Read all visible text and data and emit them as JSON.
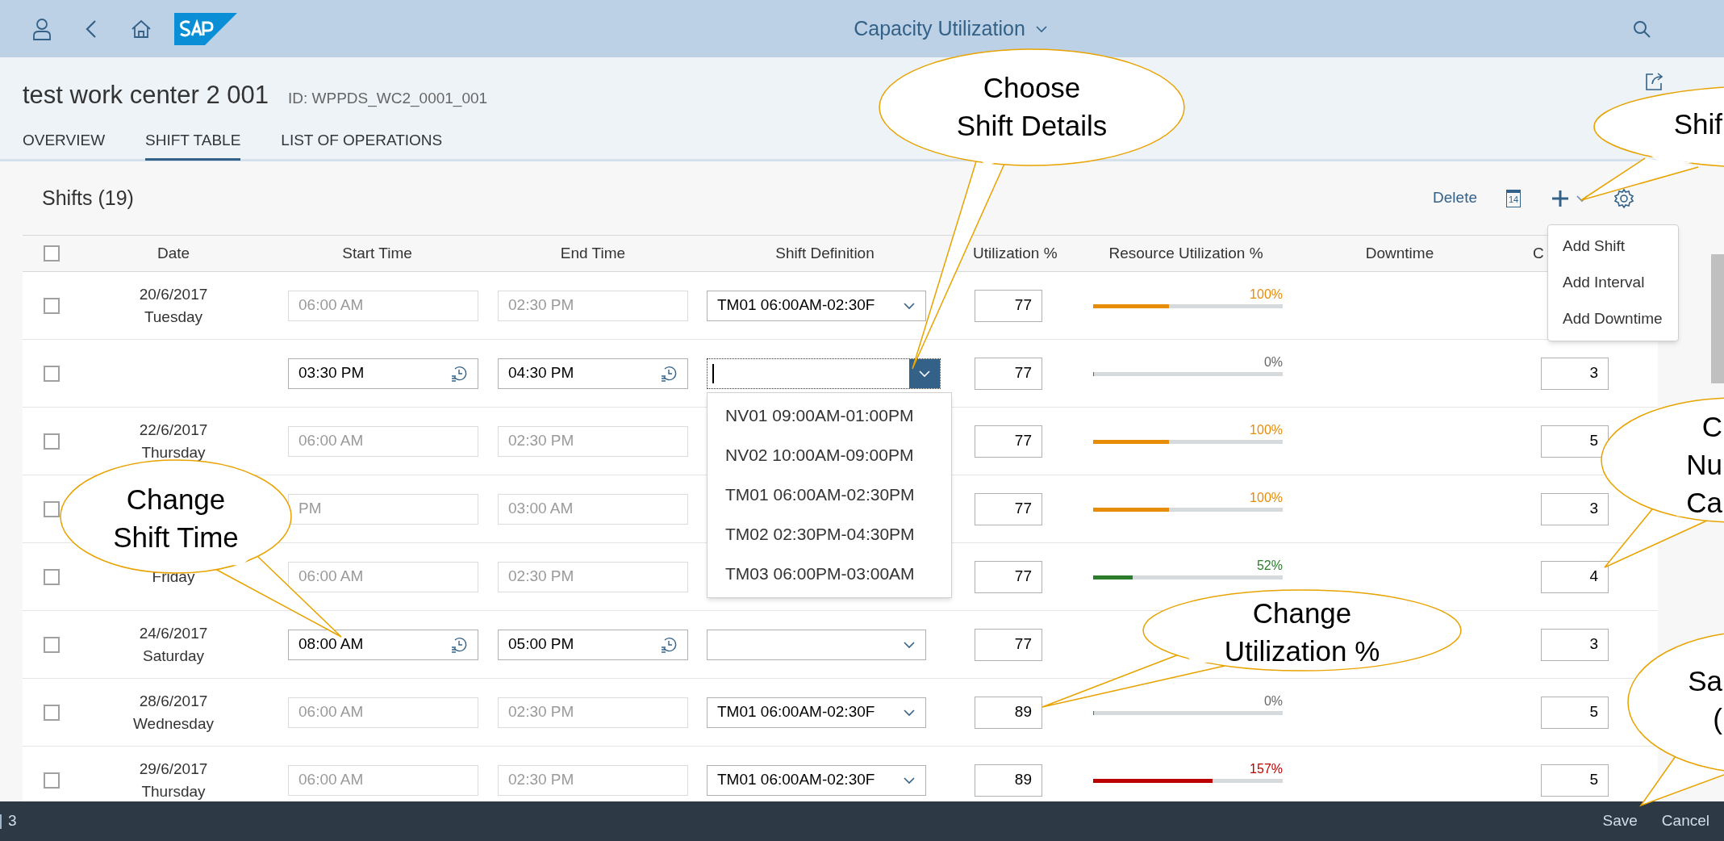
{
  "app_bar": {
    "title": "Capacity Utilization"
  },
  "object": {
    "title": "test work center 2 001",
    "id": "ID: WPPDS_WC2_0001_001"
  },
  "tabs": [
    {
      "label": "OVERVIEW",
      "selected": false
    },
    {
      "label": "SHIFT TABLE",
      "selected": true
    },
    {
      "label": "LIST OF OPERATIONS",
      "selected": false
    }
  ],
  "table": {
    "title": "Shifts (19)",
    "delete": "Delete",
    "calendar_day": "14",
    "add_menu": [
      "Add Shift",
      "Add Interval",
      "Add Downtime"
    ],
    "all_selected": false,
    "columns": [
      "Date",
      "Start Time",
      "End Time",
      "Shift Definition",
      "Utilization %",
      "Resource Utilization %",
      "Downtime",
      "C"
    ],
    "rows": [
      {
        "selected": false,
        "date": "20/6/2017",
        "day": "Tuesday",
        "start": {
          "value": "06:00 AM",
          "editable": false
        },
        "end": {
          "value": "02:30 PM",
          "editable": false
        },
        "shift": {
          "value": "TM01 06:00AM-02:30F",
          "open": false
        },
        "utilization": "77",
        "resource": {
          "reading": "100%",
          "level": 0.4,
          "color": "#e78c07"
        }
      },
      {
        "selected": false,
        "start": {
          "value": "03:30 PM",
          "editable": true
        },
        "end": {
          "value": "04:30 PM",
          "editable": true
        },
        "shift": {
          "open": true
        },
        "utilization": "77",
        "resource": {
          "reading": "0%",
          "level": 0,
          "color": "#666666"
        },
        "count": "3"
      },
      {
        "selected": false,
        "date": "22/6/2017",
        "day": "Thursday",
        "start": {
          "value": "06:00 AM",
          "editable": false
        },
        "end": {
          "value": "02:30 PM",
          "editable": false
        },
        "utilization": "77",
        "resource": {
          "reading": "100%",
          "level": 0.4,
          "color": "#e78c07"
        },
        "count": "5"
      },
      {
        "selected": false,
        "start": {
          "value": "PM",
          "editable": false
        },
        "end": {
          "value": "03:00 AM",
          "editable": false
        },
        "utilization": "77",
        "resource": {
          "reading": "100%",
          "level": 0.4,
          "color": "#e78c07"
        },
        "count": "3"
      },
      {
        "selected": false,
        "day": "Friday",
        "start": {
          "value": "06:00 AM",
          "editable": false
        },
        "end": {
          "value": "02:30 PM",
          "editable": false
        },
        "utilization": "77",
        "resource": {
          "reading": "52%",
          "level": 0.21,
          "color": "#2b7d2b"
        },
        "count": "4"
      },
      {
        "selected": false,
        "date": "24/6/2017",
        "day": "Saturday",
        "start": {
          "value": "08:00 AM",
          "editable": true
        },
        "end": {
          "value": "05:00 PM",
          "editable": true
        },
        "shift": {
          "open": false
        },
        "utilization": "77",
        "count": "3"
      },
      {
        "selected": false,
        "date": "28/6/2017",
        "day": "Wednesday",
        "start": {
          "value": "06:00 AM",
          "editable": false
        },
        "end": {
          "value": "02:30 PM",
          "editable": false
        },
        "shift": {
          "value": "TM01 06:00AM-02:30F",
          "open": false
        },
        "utilization": "89",
        "resource": {
          "reading": "0%",
          "level": 0,
          "color": "#666666"
        },
        "count": "5"
      },
      {
        "selected": false,
        "date": "29/6/2017",
        "day": "Thursday",
        "start": {
          "value": "06:00 AM",
          "editable": false
        },
        "end": {
          "value": "02:30 PM",
          "editable": false
        },
        "shift": {
          "value": "TM01 06:00AM-02:30F",
          "open": false
        },
        "utilization": "89",
        "resource": {
          "reading": "157%",
          "level": 0.63,
          "color": "#bb0000"
        },
        "count": "5"
      }
    ],
    "shift_options": [
      "NV01 09:00AM-01:00PM",
      "NV02 10:00AM-09:00PM",
      "TM01 06:00AM-02:30PM",
      "TM02 02:30PM-04:30PM",
      "TM03 06:00PM-03:00AM"
    ]
  },
  "footer": {
    "count": "3",
    "buttons": [
      "Save",
      "Cancel"
    ]
  },
  "callouts": [
    {
      "lines": [
        "Choose",
        "Shift Details"
      ]
    },
    {
      "lines": [
        "Shif"
      ]
    },
    {
      "lines": [
        "C",
        "Nu",
        "Ca"
      ]
    },
    {
      "lines": [
        "Change",
        "Shift Time"
      ]
    },
    {
      "lines": [
        "Change",
        "Utilization %"
      ]
    },
    {
      "lines": [
        "Sa",
        "("
      ]
    }
  ]
}
